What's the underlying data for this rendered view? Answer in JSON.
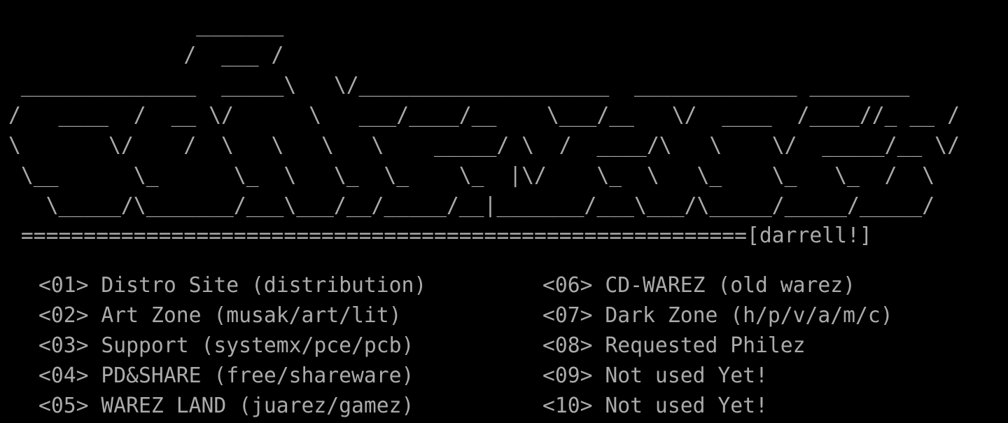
{
  "ansi_art": {
    "lines": [
      "               _______",
      "              /  ___ /",
      " ______________  _____\\   \\/____________________  _____________ ________",
      "/   ____  /  __ \\/      \\   ___/____/__    \\___/__   \\/  ____  /____//_ __ /",
      "\\       \\/    /  \\   \\   \\   \\    _____/ \\  /  ____/\\   \\    \\/  _____/__ \\/",
      " \\__      \\_      \\_  \\   \\_  \\_    \\_  |\\/    \\_  \\   \\_    \\_   \\_  /  \\",
      "   \\_____/\\_______/___\\___/__/_____/__|_______/___\\___/\\_____/_____/_____/",
      " ==========================================================[darrell!]"
    ]
  },
  "menu": {
    "left": [
      {
        "key": "<01>",
        "label": "Distro Site (distribution)"
      },
      {
        "key": "<02>",
        "label": "Art Zone (musak/art/lit)"
      },
      {
        "key": "<03>",
        "label": "Support (systemx/pce/pcb)"
      },
      {
        "key": "<04>",
        "label": "PD&SHARE (free/shareware)"
      },
      {
        "key": "<05>",
        "label": "WAREZ LAND (juarez/gamez)"
      }
    ],
    "right": [
      {
        "key": "<06>",
        "label": "CD-WAREZ (old warez)"
      },
      {
        "key": "<07>",
        "label": "Dark Zone (h/p/v/a/m/c)"
      },
      {
        "key": "<08>",
        "label": "Requested Philez"
      },
      {
        "key": "<09>",
        "label": "Not used Yet!"
      },
      {
        "key": "<10>",
        "label": "Not used Yet!"
      }
    ]
  },
  "colors": {
    "background": "#000000",
    "text": "#aaaaaa"
  }
}
